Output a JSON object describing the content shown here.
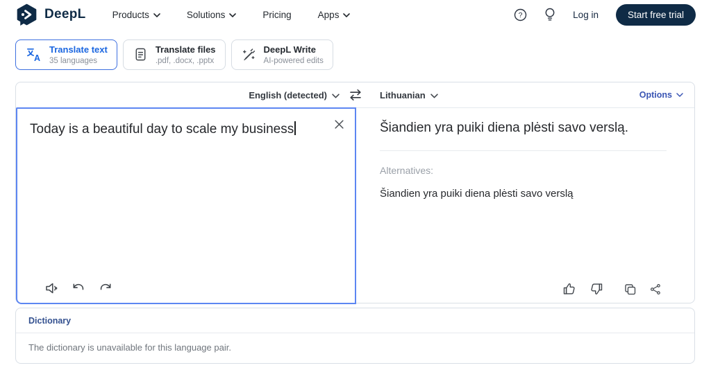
{
  "brand": {
    "name": "DeepL"
  },
  "nav": {
    "items": [
      {
        "label": "Products"
      },
      {
        "label": "Solutions"
      },
      {
        "label": "Pricing"
      },
      {
        "label": "Apps"
      }
    ],
    "login_label": "Log in",
    "cta_label": "Start free trial"
  },
  "tabs": [
    {
      "title": "Translate text",
      "subtitle": "35 languages",
      "icon": "translate-icon",
      "active": true
    },
    {
      "title": "Translate files",
      "subtitle": ".pdf, .docx, .pptx",
      "icon": "document-icon",
      "active": false
    },
    {
      "title": "DeepL Write",
      "subtitle": "AI-powered edits",
      "icon": "write-pen-icon",
      "active": false
    }
  ],
  "translator": {
    "source_language": "English (detected)",
    "target_language": "Lithuanian",
    "options_label": "Options",
    "source_text": "Today is a beautiful day to scale my business",
    "clear_label": "✕",
    "translated_text": "Šiandien yra puiki diena plėsti savo verslą.",
    "alternatives_label": "Alternatives:",
    "alternatives": [
      "Šiandien yra puiki diena plėsti savo verslą"
    ]
  },
  "dictionary": {
    "title": "Dictionary",
    "message": "The dictionary is unavailable for this language pair."
  },
  "colors": {
    "brand_navy": "#0f2b46",
    "accent_blue": "#1a66e0",
    "focus_border": "#5c86f2",
    "section_link_blue": "#33508f"
  }
}
